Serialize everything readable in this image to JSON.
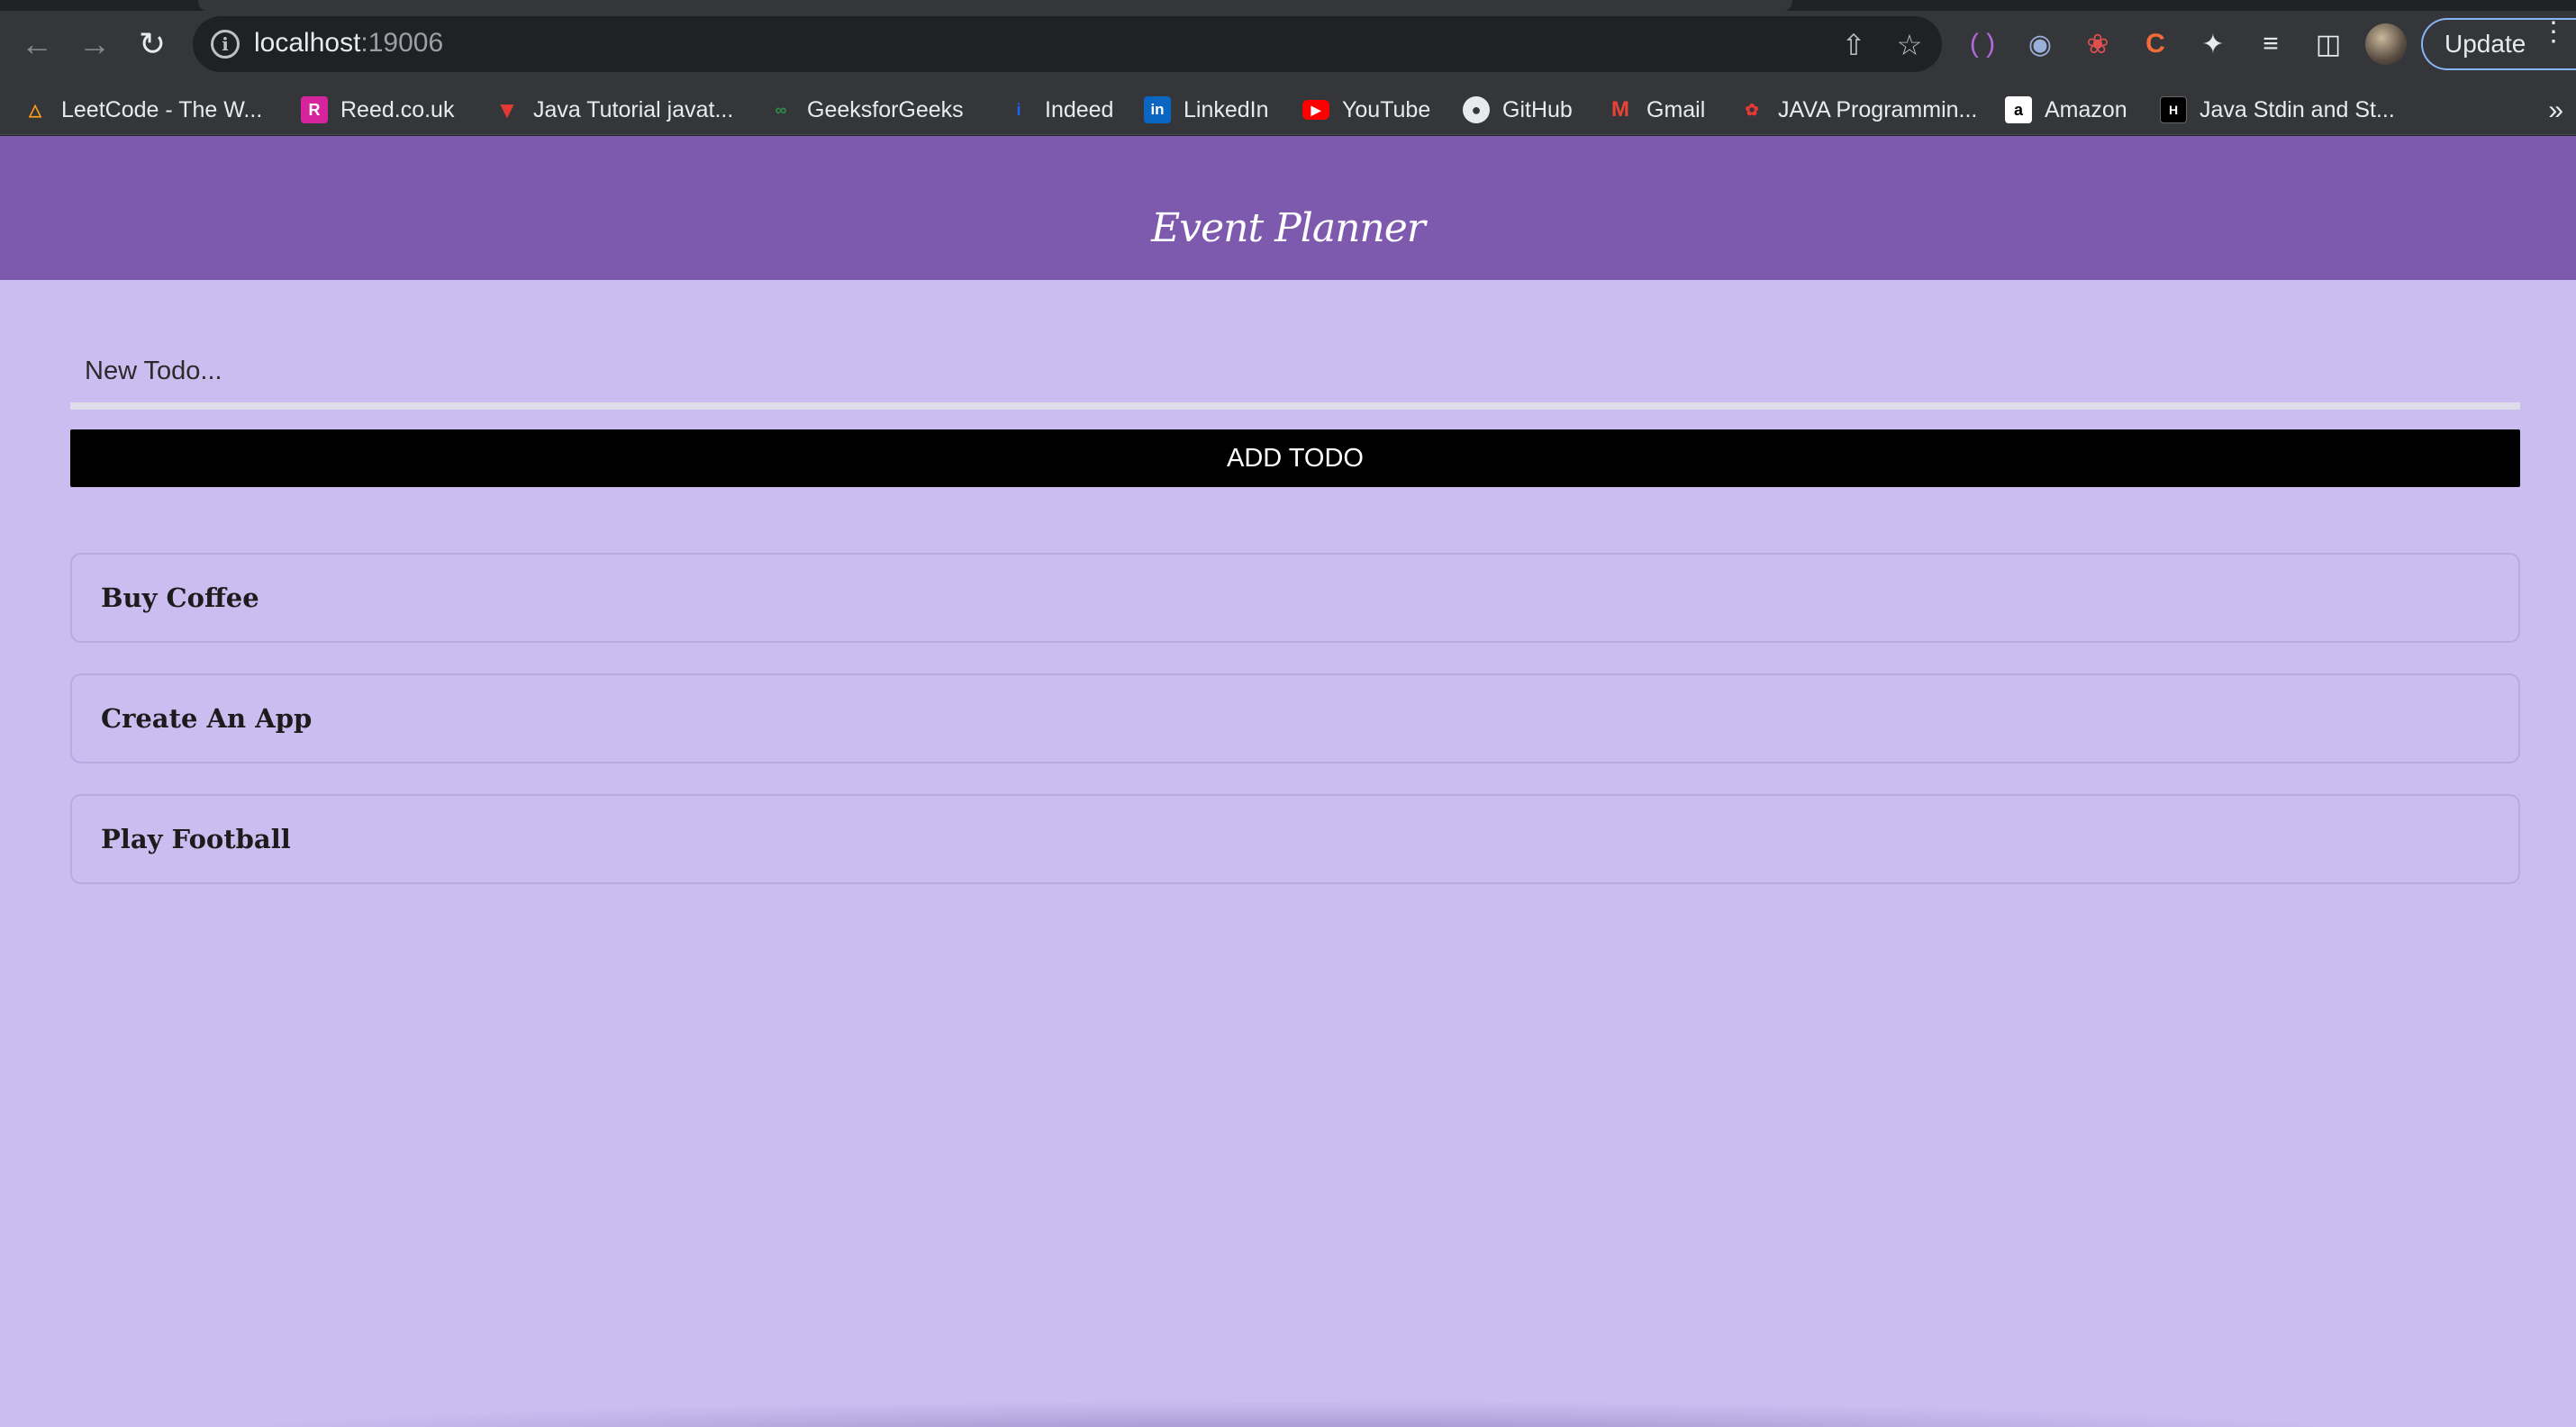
{
  "browser": {
    "url_host": "localhost",
    "url_port": ":19006",
    "update_label": "Update"
  },
  "bookmarks": [
    {
      "label": "LeetCode - The W...",
      "icon": "leetcode-icon",
      "color": "#f89f1b"
    },
    {
      "label": "Reed.co.uk",
      "icon": "reed-icon",
      "color": "#d6249f"
    },
    {
      "label": "Java Tutorial javat...",
      "icon": "javatpoint-icon",
      "color": "#e53935"
    },
    {
      "label": "GeeksforGeeks",
      "icon": "geeksforgeeks-icon",
      "color": "#2f8d46"
    },
    {
      "label": "Indeed",
      "icon": "indeed-icon",
      "color": "#2164f3"
    },
    {
      "label": "LinkedIn",
      "icon": "linkedin-icon",
      "color": "#0a66c2"
    },
    {
      "label": "YouTube",
      "icon": "youtube-icon",
      "color": "#ff0000"
    },
    {
      "label": "GitHub",
      "icon": "github-icon",
      "color": "#e8eaed"
    },
    {
      "label": "Gmail",
      "icon": "gmail-icon",
      "color": "#ea4335"
    },
    {
      "label": "JAVA Programmin...",
      "icon": "java-icon",
      "color": "#e53935"
    },
    {
      "label": "Amazon",
      "icon": "amazon-icon",
      "color": "#ffffff"
    },
    {
      "label": "Java Stdin and St...",
      "icon": "hackerrank-icon",
      "color": "#000000"
    }
  ],
  "app": {
    "title": "Event Planner",
    "input_placeholder": "New Todo...",
    "add_button_label": "ADD TODO",
    "todos": [
      "Buy Coffee",
      "Create An App",
      "Play Football"
    ]
  },
  "colors": {
    "header": "#7e5aaf",
    "background": "#cbbdf0",
    "button": "#000000"
  }
}
